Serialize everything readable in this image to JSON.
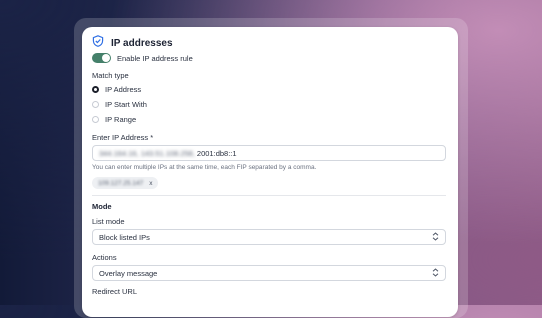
{
  "section": {
    "title": "IP addresses",
    "icon": "shield-check-icon",
    "enable_label": "Enable IP address rule",
    "enable_state": true
  },
  "match_type": {
    "label": "Match type",
    "options": [
      {
        "label": "IP Address",
        "selected": true
      },
      {
        "label": "IP Start With",
        "selected": false
      },
      {
        "label": "IP Range",
        "selected": false
      }
    ]
  },
  "ip_input": {
    "label": "Enter IP Address *",
    "value_hidden": "344.164.16, 143.51.108.258,",
    "value_visible": "2001:db8::1",
    "help": "You can enter multiple IPs at the same time, each FIP separated by a comma.",
    "chip_value": "109.127.25.147",
    "chip_remove": "x"
  },
  "mode": {
    "heading": "Mode",
    "list_mode_label": "List mode",
    "list_mode_value": "Block listed IPs",
    "actions_label": "Actions",
    "actions_value": "Overlay message",
    "redirect_label": "Redirect URL"
  },
  "colors": {
    "toggle_on": "#45806a",
    "shield": "#2f6fe4"
  }
}
